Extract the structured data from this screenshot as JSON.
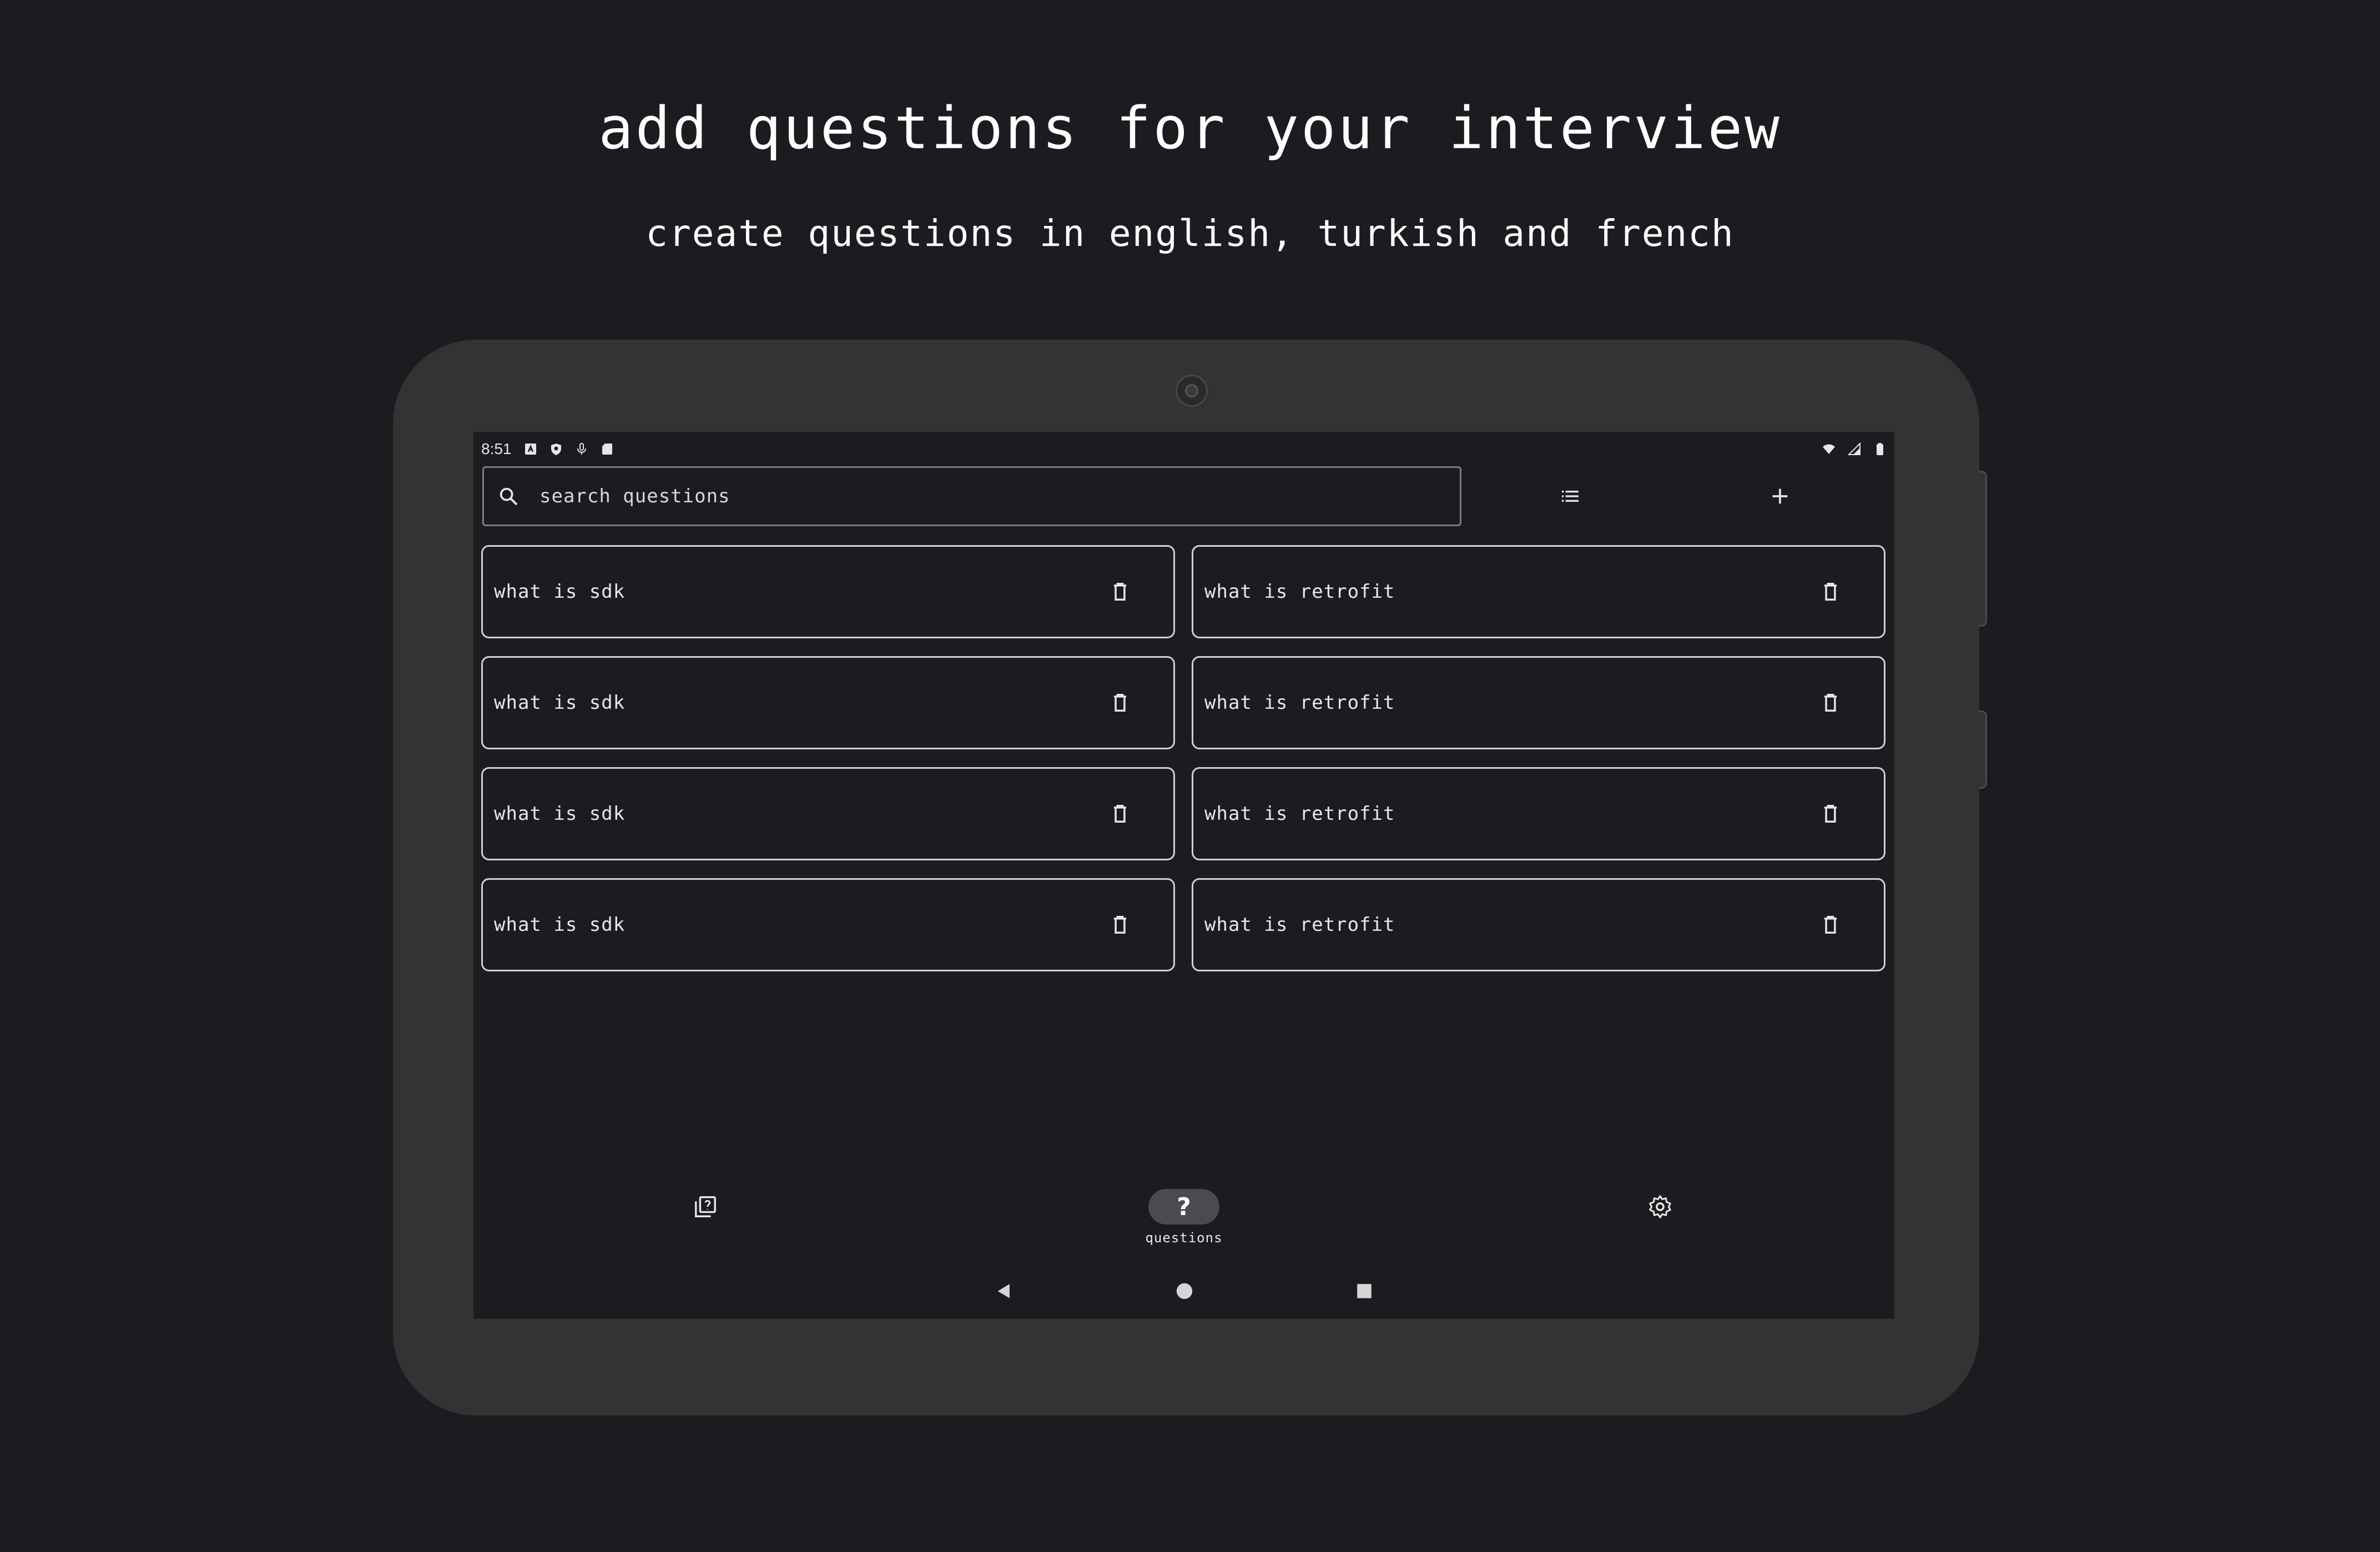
{
  "promo": {
    "headline": "add questions for your interview",
    "subline": "create questions in english, turkish and french"
  },
  "status_bar": {
    "time": "8:51",
    "left_icons": [
      "app-icon",
      "shield-icon",
      "mic-icon",
      "sd-card-icon"
    ],
    "right_icons": [
      "wifi-icon",
      "signal-icon",
      "battery-icon"
    ]
  },
  "search": {
    "placeholder": "search questions",
    "icon": "search-icon"
  },
  "toolbar": {
    "list_icon": "list-icon",
    "add_icon": "add-icon"
  },
  "questions": {
    "left": [
      "what is sdk",
      "what is sdk",
      "what is sdk",
      "what is sdk"
    ],
    "right": [
      "what is retrofit",
      "what is retrofit",
      "what is retrofit",
      "what is retrofit"
    ]
  },
  "bottom_nav": {
    "items": [
      {
        "icon": "quiz-icon",
        "label": ""
      },
      {
        "icon": "question-mark-icon",
        "glyph": "?",
        "label": "questions",
        "active": true
      },
      {
        "icon": "settings-icon",
        "label": ""
      }
    ]
  },
  "colors": {
    "background": "#1c1c20",
    "device": "#333333",
    "screen": "#1c1b1f",
    "card_border": "#d0d0d4",
    "active_pill": "#4a4a4f"
  }
}
